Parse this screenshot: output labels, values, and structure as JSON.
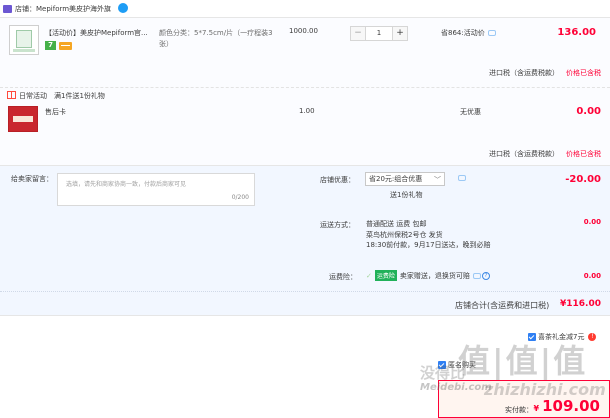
{
  "store": {
    "label": "店铺：Mepiform美皮护海外旗"
  },
  "item": {
    "title": "【活动价】美皮护Mepiform官...",
    "badge_num": "7",
    "spec": "颜色分类：5*7.5cm/片（一疗程装3张）",
    "unit_price": "1000.00",
    "quantity": "1",
    "minus_label": "−",
    "plus_label": "+",
    "discount": "省864:活动价",
    "subtotal": "136.00",
    "tax_label": "进口税（含运费税款）",
    "tax_value": "价格已含税"
  },
  "promo": {
    "name": "日常活动",
    "rule": "满1件送1份礼物",
    "gift_name": "售后卡",
    "gift_price": "1.00",
    "gift_discount": "无优惠",
    "gift_subtotal": "0.00",
    "tax_label": "进口税（含运费税款）",
    "tax_value": "价格已含税"
  },
  "message": {
    "label": "给卖家留言：",
    "placeholder": "选填，请先和商家协商一致，付款后商家可见",
    "counter": "0/200"
  },
  "coupon": {
    "label": "店铺优惠：",
    "selected": "省20元:组合优惠",
    "gift": "送1份礼物",
    "subtotal": "-20.00"
  },
  "shipping": {
    "label": "运送方式：",
    "line1": "普通配送 运费 包邮",
    "line2": "菜鸟杭州保税2号仓  发货",
    "line3": "18:30前付款，9月17日送达，晚到必赔",
    "subtotal": "0.00"
  },
  "insurance": {
    "label": "运费险：",
    "tag": "运费险",
    "text": "卖家赠送，退换货可赔",
    "help": "?",
    "subtotal": "0.00"
  },
  "store_total": {
    "label": "店铺合计(含运费和进口税)",
    "value": "¥116.00"
  },
  "gift_card": {
    "text": "喜茶礼金减7元",
    "info": "!"
  },
  "anonymous": {
    "text": "匿名购买"
  },
  "payment": {
    "label": "实付款：",
    "symbol": "¥",
    "value": "109.00"
  },
  "watermark": {
    "big": "值|值|值",
    "cn": "没得比",
    "url1": "Meidebi.com",
    "url2": "zhizhizhi.com"
  },
  "colors": {
    "price_red": "#ff0036",
    "link_blue": "#2f7ff3",
    "panel_bg": "#f2f7ff"
  }
}
